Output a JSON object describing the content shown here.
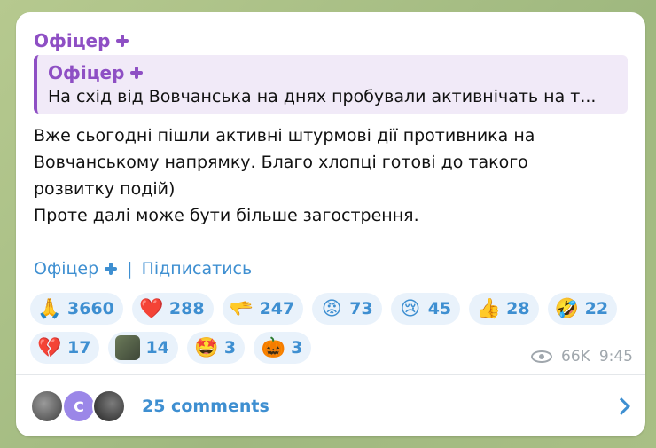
{
  "post": {
    "author": "Офіцер",
    "reply": {
      "author": "Офіцер",
      "text": "На схід від Вовчанська на днях пробували активнічать на т..."
    },
    "message_lines": [
      "Вже сьогодні пішли активні штурмові дії противника на",
      "Вовчанському напрямку. Благо хлопці готові до такого",
      "розвитку подій)",
      "Проте далі може бути більше загострення."
    ],
    "signature": {
      "channel": "Офіцер",
      "separator": "|",
      "subscribe": "Підписатись"
    },
    "reactions": [
      {
        "icon": "folded-hands-icon",
        "glyph": "🙏",
        "count": "3660"
      },
      {
        "icon": "red-heart-icon",
        "glyph": "❤️",
        "count": "288"
      },
      {
        "icon": "pointing-hand-icon",
        "glyph": "🫳",
        "count": "247"
      },
      {
        "icon": "angry-face-icon",
        "glyph": "😡",
        "count": "73"
      },
      {
        "icon": "crying-face-icon",
        "glyph": "😢",
        "count": "45"
      },
      {
        "icon": "thumbs-up-icon",
        "glyph": "👍",
        "count": "28"
      },
      {
        "icon": "rofl-face-icon",
        "glyph": "🤣",
        "count": "22"
      },
      {
        "icon": "broken-heart-icon",
        "glyph": "💔",
        "count": "17"
      },
      {
        "icon": "custom-avatar-emoji-icon",
        "glyph": "",
        "count": "14"
      },
      {
        "icon": "star-struck-face-icon",
        "glyph": "🤩",
        "count": "3"
      },
      {
        "icon": "pumpkin-icon",
        "glyph": "🎃",
        "count": "3"
      }
    ],
    "views": "66K",
    "time": "9:45",
    "comments": {
      "avatar_initial": "C",
      "label": "25 comments"
    }
  },
  "colors": {
    "author": "#8e4fc4",
    "link": "#3e8fd1",
    "chip_bg": "#e9f2fb",
    "meta": "#a0a7ad"
  }
}
